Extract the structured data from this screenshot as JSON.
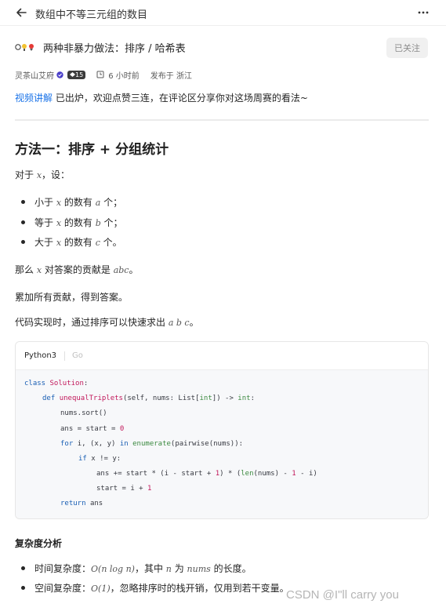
{
  "topbar": {
    "title": "数组中不等三元组的数目"
  },
  "header": {
    "title": "两种非暴力做法：排序 / 哈希表",
    "follow_label": "已关注"
  },
  "meta": {
    "author": "灵茶山艾府",
    "level": "15",
    "time": "6 小时前",
    "location": "发布于 浙江"
  },
  "intro": {
    "link": "视频讲解",
    "text": " 已出炉，欢迎点赞三连，在评论区分享你对这场周赛的看法~"
  },
  "section1": {
    "heading": "方法一：排序 + 分组统计",
    "p1": "对于 ",
    "p1_var": "x",
    "p1_end": "，设：",
    "bullets": [
      {
        "pre": "小于 ",
        "var": "x",
        "mid": " 的数有 ",
        "var2": "a",
        "post": " 个；"
      },
      {
        "pre": "等于 ",
        "var": "x",
        "mid": " 的数有 ",
        "var2": "b",
        "post": " 个；"
      },
      {
        "pre": "大于 ",
        "var": "x",
        "mid": " 的数有 ",
        "var2": "c",
        "post": " 个。"
      }
    ],
    "p2_pre": "那么 ",
    "p2_var": "x",
    "p2_mid": " 对答案的贡献是 ",
    "p2_var2": "abc",
    "p2_post": "。",
    "p3": "累加所有贡献，得到答案。",
    "p4_pre": "代码实现时，通过排序可以快速求出 ",
    "p4_var": "a b c",
    "p4_post": "。"
  },
  "code": {
    "tabs": [
      "Python3",
      "Go"
    ],
    "lines": {
      "l1_kw": "class ",
      "l1_cls": "Solution",
      "l1_end": ":",
      "l2_kw": "def ",
      "l2_fn": "unequalTriplets",
      "l2_a": "(self, nums: List[",
      "l2_bi": "int",
      "l2_b": "]) -> ",
      "l2_bi2": "int",
      "l2_c": ":",
      "l3": "nums.sort()",
      "l4_a": "ans = start = ",
      "l4_num": "0",
      "l5_kw": "for ",
      "l5_a": "i, (x, y) ",
      "l5_kw2": "in ",
      "l5_bi": "enumerate",
      "l5_b": "(pairwise(nums)):",
      "l6_kw": "if ",
      "l6_a": "x != y:",
      "l7_a": "ans += start * (i - start + ",
      "l7_num": "1",
      "l7_b": ") * (",
      "l7_bi": "len",
      "l7_c": "(nums) - ",
      "l7_num2": "1",
      "l7_d": " - i)",
      "l8_a": "start = i + ",
      "l8_num": "1",
      "l9_kw": "return ",
      "l9_a": "ans"
    }
  },
  "complexity": {
    "heading": "复杂度分析",
    "items": [
      {
        "pre": "时间复杂度：",
        "math": "O(n log n)",
        "mid": "，其中 ",
        "var": "n",
        "mid2": " 为 ",
        "var2": "nums",
        "post": " 的长度。"
      },
      {
        "pre": "空间复杂度：",
        "math": "O(1)",
        "post": "，忽略排序时的栈开销，仅用到若干变量。"
      }
    ]
  },
  "watermark": "CSDN @I\"ll  carry  you"
}
